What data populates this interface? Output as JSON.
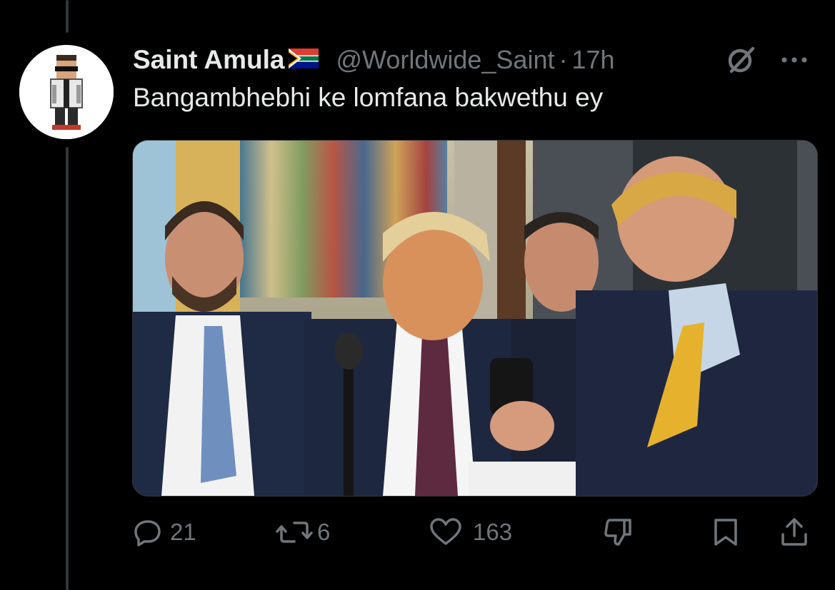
{
  "tweet": {
    "display_name": "Saint Amula",
    "flag_icon": "south-africa-flag-icon",
    "handle": "@Worldwide_Saint",
    "separator": "·",
    "time": "17h",
    "text": "Bangambhebhi ke lomfana bakwethu ey",
    "media": {
      "type": "video-thumbnail"
    }
  },
  "actions": {
    "reply_count": "21",
    "repost_count": "6",
    "like_count": "163"
  },
  "colors": {
    "background": "#000000",
    "primary_text": "#e7e9ea",
    "secondary_text": "#71767b",
    "thread_line": "#333639"
  }
}
